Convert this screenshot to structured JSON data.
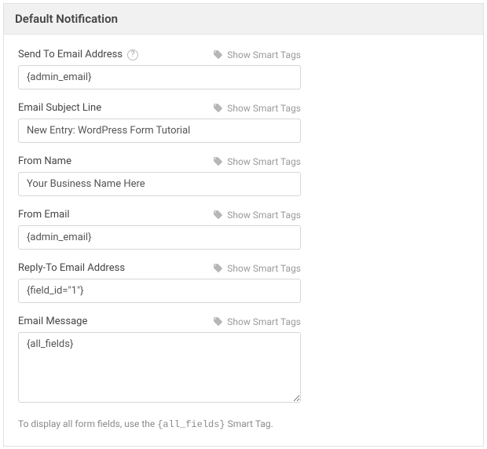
{
  "header": {
    "title": "Default Notification"
  },
  "smartTagsLabel": "Show Smart Tags",
  "fields": {
    "sendTo": {
      "label": "Send To Email Address",
      "value": "{admin_email}",
      "showHelp": true
    },
    "subject": {
      "label": "Email Subject Line",
      "value": "New Entry: WordPress Form Tutorial"
    },
    "fromName": {
      "label": "From Name",
      "value": "Your Business Name Here"
    },
    "fromEmail": {
      "label": "From Email",
      "value": "{admin_email}"
    },
    "replyTo": {
      "label": "Reply-To Email Address",
      "value": "{field_id=\"1\"}"
    },
    "message": {
      "label": "Email Message",
      "value": "{all_fields}"
    }
  },
  "hint": {
    "prefix": "To display all form fields, use the ",
    "code": "{all_fields}",
    "suffix": " Smart Tag."
  }
}
